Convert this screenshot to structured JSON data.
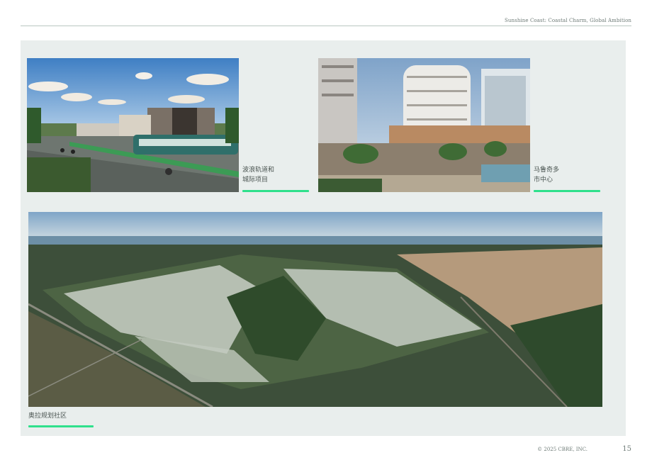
{
  "header": {
    "title": "Sunshine Coast: Coastal Charm, Global Ambition"
  },
  "photos": [
    {
      "name": "Wave light rail and intercity project",
      "caption_lines": [
        "波浪轨道和",
        "城际项目"
      ]
    },
    {
      "name": "Maroochydore city centre",
      "caption_lines": [
        "马鲁奇多",
        "市中心"
      ]
    },
    {
      "name": "Aura planned community",
      "caption_lines": [
        "奥拉规划社区"
      ]
    }
  ],
  "colors": {
    "accent": "#2fe08c",
    "panel": "#e9eeed",
    "rule": "#b9c8c1"
  },
  "footer": {
    "copyright": "© 2025 CBRE, INC.",
    "page_number": "15"
  }
}
